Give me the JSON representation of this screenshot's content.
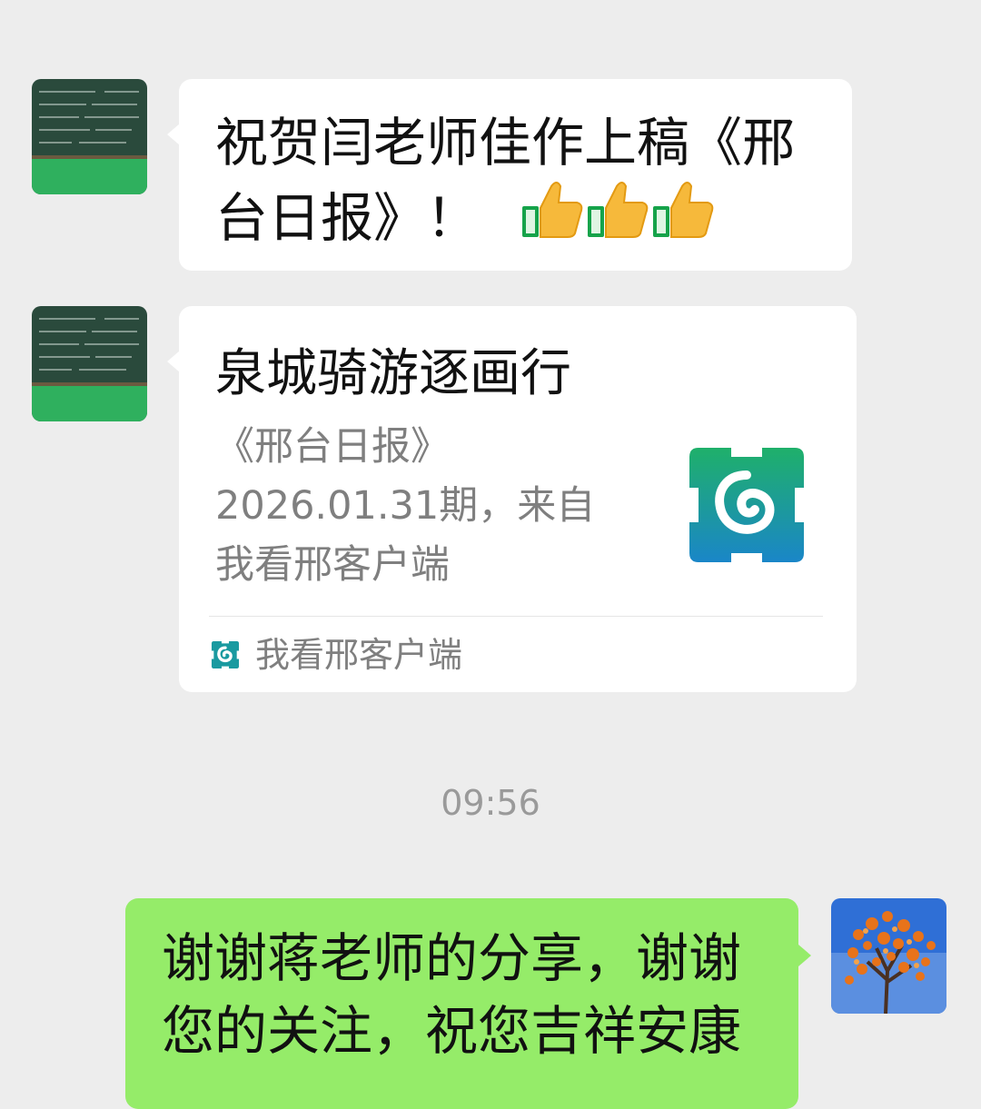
{
  "messages": [
    {
      "sender": "contact",
      "text_line1": "祝贺闫老师佳作上稿《邢",
      "text_line2": "台日报》！",
      "emoji": [
        "thumbs-up",
        "thumbs-up",
        "thumbs-up"
      ]
    },
    {
      "sender": "contact",
      "card": {
        "title": "泉城骑游逐画行",
        "desc_line1": "《邢台日报》",
        "desc_line2": "2026.01.31期，来自",
        "desc_line3": "我看邢客户端",
        "source": "我看邢客户端",
        "logo_icon": "app-logo-icon"
      }
    },
    {
      "timestamp": "09:56"
    },
    {
      "sender": "me",
      "text_line1": "谢谢蒋老师的分享，谢谢",
      "text_line2": "您的关注，祝您吉祥安康"
    }
  ],
  "colors": {
    "background": "#ededed",
    "bubble_received": "#ffffff",
    "bubble_sent": "#95ec69",
    "secondary_text": "#7f7f7f",
    "app_logo_green": "#1aa86b",
    "app_logo_blue": "#1a86c8"
  }
}
